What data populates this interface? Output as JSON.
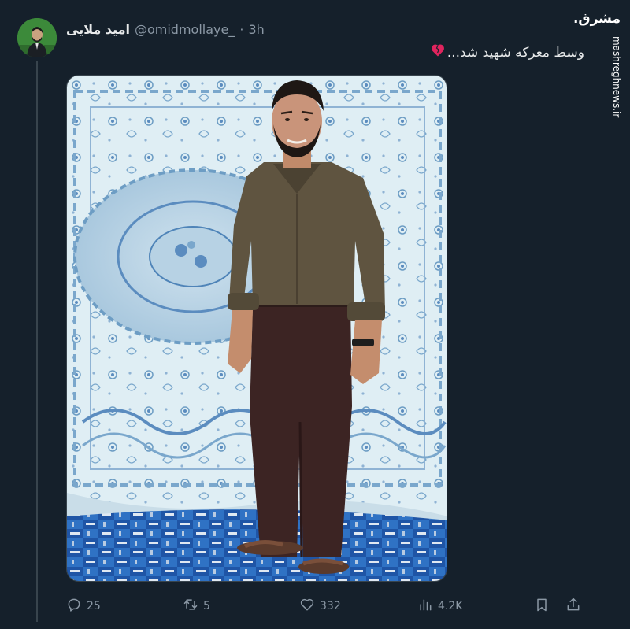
{
  "tweet": {
    "display_name": "امید ملایی",
    "handle": "@omidmollaye_",
    "separator": "·",
    "time": "3h",
    "text": "وسط معرکه شهید شد...",
    "text_emoji_icon": "broken-heart-icon",
    "image_alt_icon": "tweet-photo"
  },
  "watermark": {
    "logo_text": "مشرق.",
    "site": "mashreghnews.ir"
  },
  "actions": {
    "reply": {
      "icon": "reply-icon",
      "count": "25"
    },
    "retweet": {
      "icon": "retweet-icon",
      "count": "5"
    },
    "like": {
      "icon": "heart-icon",
      "count": "332"
    },
    "views": {
      "icon": "views-icon",
      "count": "4.2K"
    },
    "bookmark": {
      "icon": "bookmark-icon"
    },
    "share": {
      "icon": "share-icon"
    }
  },
  "colors": {
    "background": "#15202b",
    "text_primary": "#e7e9ea",
    "text_secondary": "#8b98a5",
    "broken_heart": "#e0245e",
    "avatar_green": "#3c8a3a"
  }
}
